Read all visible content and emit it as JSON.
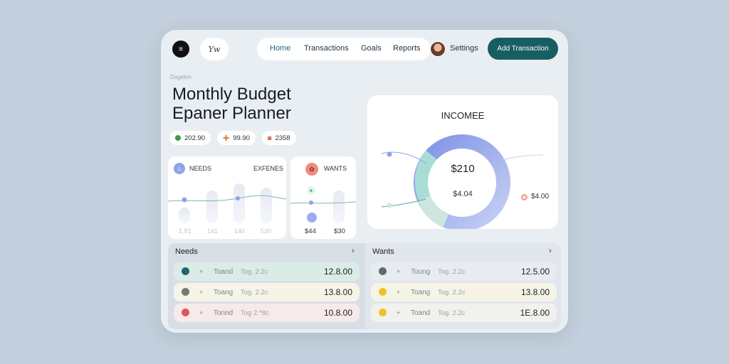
{
  "header": {
    "logo_text": "≡",
    "signature": "Yw",
    "nav": [
      "Home",
      "Transactions",
      "Goals",
      "Reports"
    ],
    "settings_label": "Settings",
    "add_button": "Add Transaction"
  },
  "breadcrumb": "Dogelon",
  "page_title": [
    "Monthly Budget",
    "Epaner Planner"
  ],
  "chips": [
    {
      "value": "202.90",
      "color": "#3f9a4b",
      "icon": "dot"
    },
    {
      "value": "99.90",
      "color": "#d88a2a",
      "icon": "plus"
    },
    {
      "value": "2358",
      "color": "#c65a4d",
      "icon": "bag"
    }
  ],
  "needs_card": {
    "title": "NEEDS",
    "right_label": "EXFENES",
    "labels": [
      "1.81",
      "141",
      "140",
      "530"
    ]
  },
  "wants_card": {
    "title": "WANTS",
    "labels": [
      "$44",
      "$30"
    ]
  },
  "income": {
    "title": "INCOMEE",
    "center_value": "$210",
    "center_sub": "$4.04",
    "side_value": "$4.00"
  },
  "colors": {
    "accent": "#175e63",
    "ring_blue": "#8ea3ea",
    "ring_teal": "#a9dcd5"
  },
  "needs_panel": {
    "title": "Needs",
    "rows": [
      {
        "name": "Toand",
        "tag": "Tog. 2.2c",
        "amount": "12.8.00",
        "dot": "#1c6a70",
        "bg": "#d9ece8"
      },
      {
        "name": "Toang",
        "tag": "Tog. 2.2c",
        "amount": "13.8.00",
        "dot": "#6d7c78",
        "bg": "#f6f4e6"
      },
      {
        "name": "Tonnd",
        "tag": "Tog 2.*8c",
        "amount": "10.8.00",
        "dot": "#e0565c",
        "bg": "#f7eaea"
      }
    ]
  },
  "wants_panel": {
    "title": "Wants",
    "rows": [
      {
        "name": "Toung",
        "tag": "Tog. 2.2c",
        "amount": "12.5.00",
        "dot": "#5b6e6a",
        "bg": "#e8ecf0"
      },
      {
        "name": "Toang",
        "tag": "Tog. 2.2c",
        "amount": "13.8.00",
        "dot": "#f0c02e",
        "bg": "#f6f4e6"
      },
      {
        "name": "Toand",
        "tag": "Tog. 2.2c",
        "amount": "1E.8.00",
        "dot": "#f0c02e",
        "bg": "#f1f1ed"
      }
    ]
  }
}
